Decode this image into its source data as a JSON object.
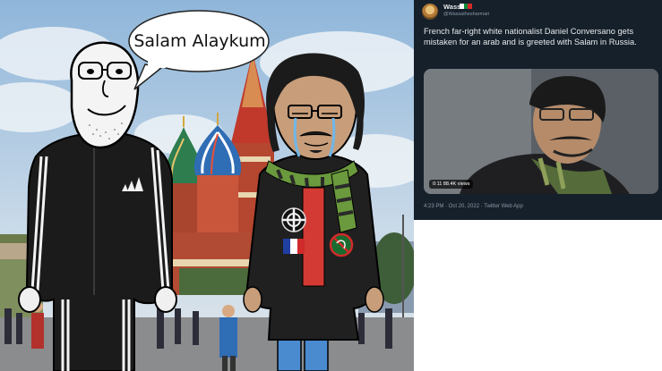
{
  "meme": {
    "speech_text": "Salam Alaykum"
  },
  "tweet": {
    "display_name": "Wass",
    "flag_colors": [
      "#ffffff",
      "#0b8a3e",
      "#d62828"
    ],
    "handle": "@Wassathesharmari",
    "text": "French far-right white nationalist Daniel Conversano gets mistaken for an arab and is greeted with Salam in Russia.",
    "media_badge": "0:11  88.4K views",
    "meta": "4:23 PM · Oct 20, 2022 · Twitter Web App"
  }
}
